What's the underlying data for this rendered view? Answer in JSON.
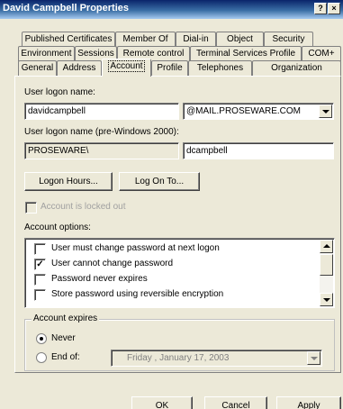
{
  "window": {
    "title": "David Campbell Properties",
    "help_button": "?",
    "close_button": "×"
  },
  "tabs": {
    "row1": [
      "Published Certificates",
      "Member Of",
      "Dial-in",
      "Object",
      "Security"
    ],
    "row2": [
      "Environment",
      "Sessions",
      "Remote control",
      "Terminal Services Profile",
      "COM+"
    ],
    "row3": [
      "General",
      "Address",
      "Account",
      "Profile",
      "Telephones",
      "Organization"
    ],
    "active": "Account"
  },
  "account": {
    "logon_name_label": "User logon name:",
    "logon_name_value": "davidcampbell",
    "domain_suffix": "@MAIL.PROSEWARE.COM",
    "pre2000_label": "User logon name (pre-Windows 2000):",
    "pre2000_domain": "PROSEWARE\\",
    "pre2000_user": "dcampbell",
    "logon_hours_button": "Logon Hours...",
    "logon_to_button": "Log On To...",
    "locked_out_label": "Account is locked out",
    "options_label": "Account options:",
    "options": [
      {
        "label": "User must change password at next logon",
        "checked": false
      },
      {
        "label": "User cannot change password",
        "checked": true
      },
      {
        "label": "Password never expires",
        "checked": false
      },
      {
        "label": "Store password using reversible encryption",
        "checked": false
      }
    ],
    "expires_label": "Account expires",
    "never_label": "Never",
    "end_of_label": "End of:",
    "end_date_value": "Friday    ,   January   17, 2003"
  },
  "footer": {
    "ok_button": "OK",
    "cancel_button": "Cancel",
    "apply_button": "Apply"
  },
  "colors": {
    "titlebar_start": "#0a246a",
    "titlebar_end": "#a6caf0",
    "dialog_face": "#ece9d8"
  }
}
